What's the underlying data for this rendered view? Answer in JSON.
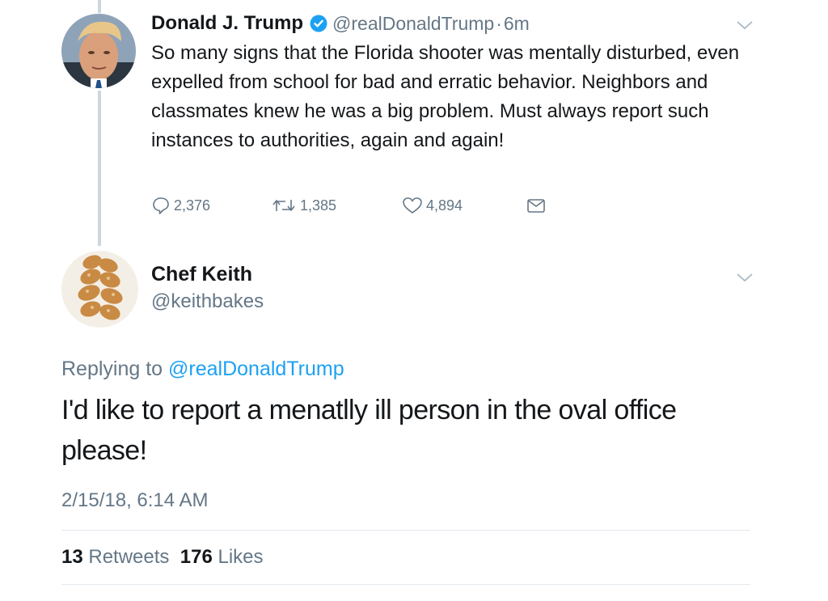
{
  "original_tweet": {
    "author_name": "Donald J. Trump",
    "handle": "@realDonaldTrump",
    "separator": "·",
    "time": "6m",
    "text": "So many signs that the Florida shooter was mentally disturbed, even expelled from school for bad and erratic behavior. Neighbors and classmates knew he was a big problem. Must always report such instances to authorities, again and again!",
    "replies": "2,376",
    "retweets": "1,385",
    "likes": "4,894",
    "verified": true,
    "icons": [
      "reply-icon",
      "retweet-icon",
      "like-icon",
      "direct-message-icon",
      "chevron-down-icon",
      "verified-badge-icon"
    ]
  },
  "reply_tweet": {
    "author_name": "Chef Keith",
    "handle": "@keithbakes",
    "replying_prefix": "Replying to",
    "replying_to": "@realDonaldTrump",
    "text": "I'd like to report a menatlly ill person in the oval office please!",
    "timestamp": "2/15/18, 6:14 AM",
    "retweet_count": "13",
    "retweet_label": "Retweets",
    "like_count": "176",
    "like_label": "Likes"
  },
  "colors": {
    "accent": "#1da1f2",
    "secondary_text": "#657786",
    "primary_text": "#14171a",
    "thread_line": "#ccd6dd",
    "divider": "#e1e8ed"
  }
}
